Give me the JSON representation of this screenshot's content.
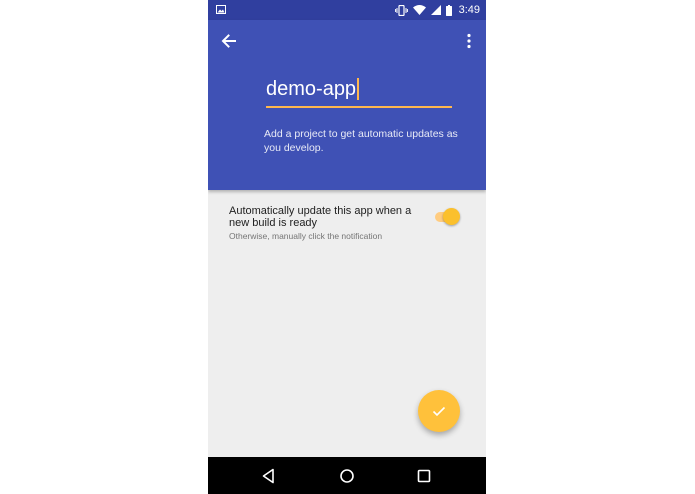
{
  "status_bar": {
    "time": "3:49",
    "icons": [
      "image-icon",
      "vibrate-icon",
      "wifi-icon",
      "signal-icon",
      "battery-icon"
    ]
  },
  "toolbar": {
    "back_icon": "arrow-back-icon",
    "menu_icon": "more-vert-icon"
  },
  "project": {
    "value": "demo-app",
    "helper": "Add a project to get automatic updates as you develop."
  },
  "setting": {
    "title": "Automatically update this app when a new build is ready",
    "subtitle": "Otherwise, manually click the notification",
    "enabled": true
  },
  "fab": {
    "icon": "check-icon"
  },
  "nav": {
    "icons": [
      "nav-back-icon",
      "nav-home-icon",
      "nav-recents-icon"
    ]
  },
  "colors": {
    "primary": "#3f51b5",
    "primary_dark": "#303f9f",
    "accent": "#ffc13b",
    "background": "#eeeeee"
  }
}
